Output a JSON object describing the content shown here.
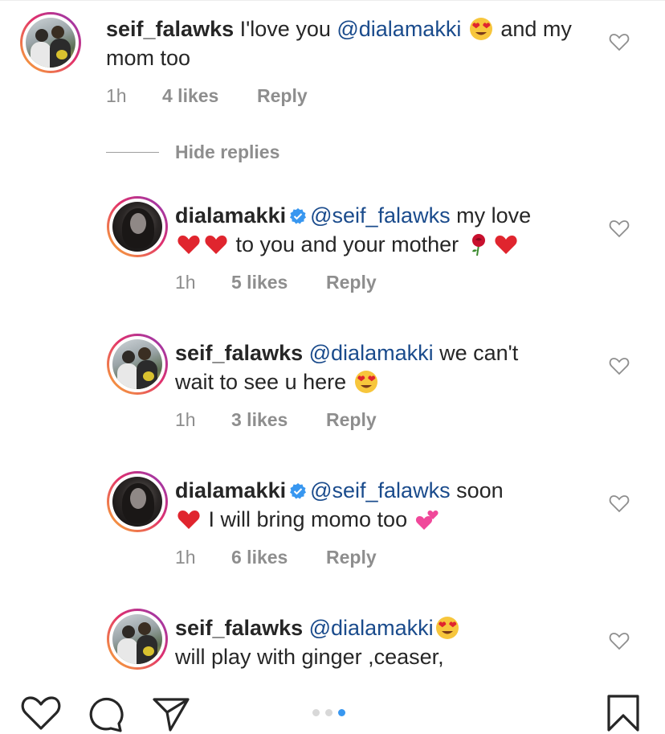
{
  "comments": [
    {
      "user": "seif_falawks",
      "text_before": "I'love you ",
      "mention": "@dialamakki",
      "text_after": " and my mom too",
      "time": "1h",
      "likes": "4 likes",
      "reply": "Reply"
    },
    {
      "user": "dialamakki",
      "mention": "@seif_falawks",
      "text_line1": " my love",
      "text_line2": " to you and your mother ",
      "time": "1h",
      "likes": "5 likes",
      "reply": "Reply"
    },
    {
      "user": "seif_falawks",
      "mention": "@dialamakki",
      "text_line1": " we can't",
      "text_line2": "wait to see u here ",
      "time": "1h",
      "likes": "3 likes",
      "reply": "Reply"
    },
    {
      "user": "dialamakki",
      "mention": "@seif_falawks",
      "text_line1": " soon",
      "text_line2": " I will bring momo too ",
      "time": "1h",
      "likes": "6 likes",
      "reply": "Reply"
    },
    {
      "user": "seif_falawks",
      "mention": "@dialamakki",
      "text_line1": "",
      "text_line2": "will play with ginger ,ceaser,"
    }
  ],
  "hide_replies": "Hide replies",
  "colors": {
    "mention": "#1a4b8c",
    "meta": "#8e8e8e",
    "verified": "#3897f0",
    "heart_red": "#e0252e",
    "active_dot": "#3897f0"
  },
  "icons": [
    "heart-outline-icon",
    "comment-icon",
    "share-icon",
    "bookmark-icon",
    "verified-badge-icon",
    "heart-eyes-emoji",
    "red-heart-emoji",
    "rose-emoji",
    "two-hearts-emoji"
  ],
  "carousel": {
    "total": 3,
    "active": 3
  }
}
